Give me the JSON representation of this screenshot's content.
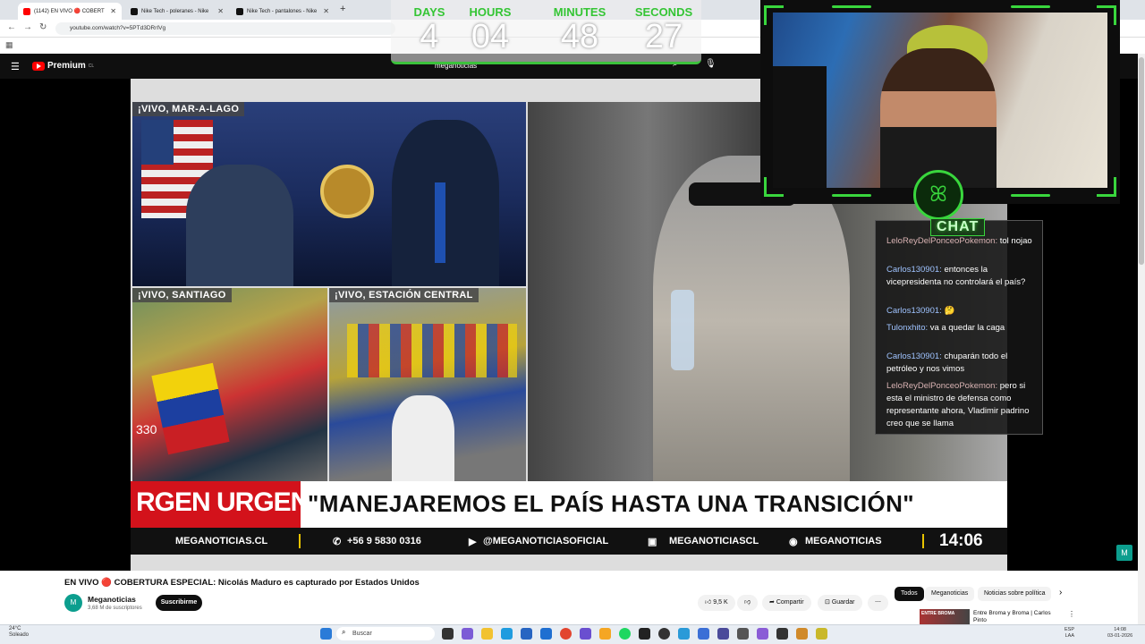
{
  "browser": {
    "tabs": [
      {
        "label": "(1142) EN VIVO 🔴 COBERT",
        "active": true
      },
      {
        "label": "Nike Tech - poleranes - Nike",
        "active": false
      },
      {
        "label": "Nike Tech - pantalones - Nike",
        "active": false
      }
    ],
    "url": "youtube.com/watch?v=5PTd3DRrIVg",
    "new_tab": "+"
  },
  "youtube": {
    "logo_text": "Premium",
    "logo_region": "CL",
    "search_query": "meganoticias"
  },
  "countdown": {
    "days_label": "DAYS",
    "days": "4",
    "hours_label": "HOURS",
    "hours": "04",
    "minutes_label": "MINUTES",
    "minutes": "48",
    "seconds_label": "SECONDS",
    "seconds": "27"
  },
  "video": {
    "label_mar": "¡VIVO, MAR-A-LAGO",
    "label_stg": "¡VIVO, SANTIAGO",
    "label_est": "¡VIVO, ESTACIÓN CENTRAL",
    "urgent": "RGEN URGENTE",
    "headline": "\"MANEJAREMOS EL PAÍS HASTA UNA TRANSICIÓN\"",
    "bottom_site": "MEGANOTICIAS.CL",
    "bottom_phone": "+56 9 5830 0316",
    "bottom_yt": "@MEGANOTICIASOFICIAL",
    "bottom_twitch": "MEGANOTICIASCL",
    "bottom_spotify": "MEGANOTICIAS",
    "time": "14:06",
    "pane_number": "330"
  },
  "chat": {
    "title": "CHAT",
    "messages": [
      {
        "user": "LeloReyDelPonceoPokemon:",
        "text": "tol nojao"
      },
      {
        "user": "Carlos130901:",
        "text": "entonces la vicepresidenta no controlará el país?"
      },
      {
        "user": "Carlos130901:",
        "text": "🤔"
      },
      {
        "user": "Tulonxhito:",
        "text": "va a quedar la caga"
      },
      {
        "user": "Carlos130901:",
        "text": "chuparán todo el petróleo y nos vimos"
      },
      {
        "user": "LeloReyDelPonceoPokemon:",
        "text": "pero si esta el ministro de defensa como representante ahora, Vladimir padrino creo que se llama"
      }
    ]
  },
  "below": {
    "title": "EN VIVO 🔴 COBERTURA ESPECIAL: Nicolás Maduro es capturado por Estados Unidos",
    "channel": "Meganoticias",
    "subscribers": "3,68 M de suscriptores",
    "subscribe": "Suscribirme",
    "likes": "9,5 K",
    "share": "Compartir",
    "save": "Guardar",
    "chips": [
      "Todos",
      "Meganoticias",
      "Noticias sobre política"
    ],
    "rec_title": "Entre Broma y Broma | Carlos Pinto",
    "rec_thumb": "ENTRE BROMA"
  },
  "taskbar": {
    "temp": "24°C",
    "weather": "Soleado",
    "search": "Buscar",
    "lang1": "ESP",
    "lang2": "LAA",
    "time": "14:08",
    "date": "03-01-2026"
  },
  "colors": {
    "accent_green": "#39d63d",
    "yt_red": "#ff0000",
    "urgent_red": "#d3121b"
  }
}
